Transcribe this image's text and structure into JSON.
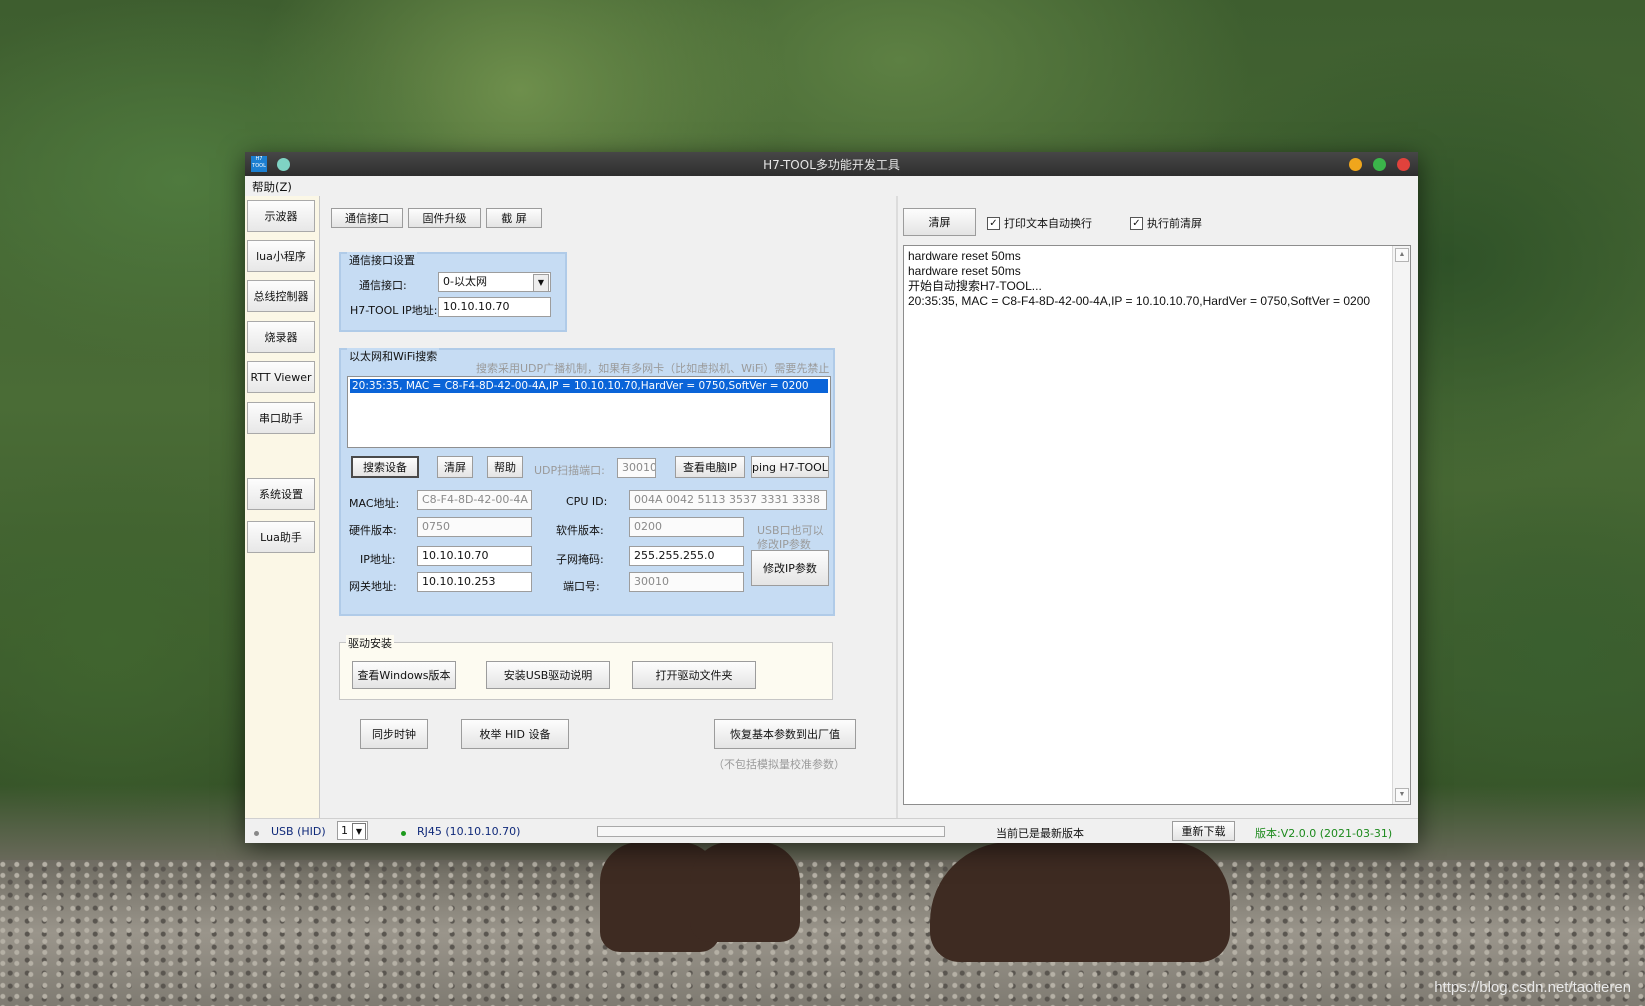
{
  "window": {
    "title": "H7-TOOL多功能开发工具",
    "logo_text": "H7 TOOL"
  },
  "menubar": {
    "help": "帮助(Z)"
  },
  "sidebar": {
    "items": [
      "示波器",
      "lua小程序",
      "总线控制器",
      "烧录器",
      "RTT Viewer",
      "串口助手",
      "系统设置",
      "Lua助手"
    ]
  },
  "tabs": [
    "通信接口",
    "固件升级",
    "截 屏"
  ],
  "comm_settings": {
    "title": "通信接口设置",
    "interface_label": "通信接口:",
    "interface_value": "0-以太网",
    "ip_label": "H7-TOOL IP地址:",
    "ip_value": "10.10.10.70"
  },
  "search": {
    "title": "以太网和WiFi搜索",
    "hint": "搜索采用UDP广播机制，如果有多网卡（比如虚拟机、WiFi）需要先禁止",
    "results": [
      "20:35:35, MAC = C8-F4-8D-42-00-4A,IP = 10.10.10.70,HardVer = 0750,SoftVer = 0200"
    ],
    "search_btn": "搜索设备",
    "clear_btn": "清屏",
    "help_btn": "帮助",
    "udp_port_label": "UDP扫描端口:",
    "udp_port_value": "30010",
    "view_pc_ip_btn": "查看电脑IP",
    "ping_btn": "ping H7-TOOL",
    "mac_label": "MAC地址:",
    "mac_value": "C8-F4-8D-42-00-4A",
    "cpu_label": "CPU ID:",
    "cpu_value": "004A 0042 5113 3537 3331 3338",
    "hw_label": "硬件版本:",
    "hw_value": "0750",
    "sw_label": "软件版本:",
    "sw_value": "0200",
    "usb_note_1": "USB口也可以",
    "usb_note_2": "修改IP参数",
    "ip_label": "IP地址:",
    "ip_value": "10.10.10.70",
    "mask_label": "子网掩码:",
    "mask_value": "255.255.255.0",
    "modify_btn": "修改IP参数",
    "gw_label": "网关地址:",
    "gw_value": "10.10.10.253",
    "port_label": "端口号:",
    "port_value": "30010"
  },
  "driver": {
    "title": "驱动安装",
    "btn1": "查看Windows版本",
    "btn2": "安装USB驱动说明",
    "btn3": "打开驱动文件夹"
  },
  "bottom": {
    "sync_btn": "同步时钟",
    "hid_btn": "枚举 HID 设备",
    "restore_btn": "恢复基本参数到出厂值",
    "restore_note": "（不包括模拟量校准参数）"
  },
  "log": {
    "clear_btn": "清屏",
    "wrap_label": "打印文本自动换行",
    "clear_before_label": "执行前清屏",
    "lines": [
      "hardware reset 50ms",
      "hardware reset 50ms",
      "开始自动搜索H7-TOOL...",
      "20:35:35, MAC = C8-F4-8D-42-00-4A,IP = 10.10.10.70,HardVer = 0750,SoftVer = 0200"
    ]
  },
  "status": {
    "usb": "USB (HID)",
    "channel": "1",
    "rj45": "RJ45 (10.10.10.70)",
    "latest": "当前已是最新版本",
    "redownload_btn": "重新下载",
    "version": "版本:V2.0.0 (2021-03-31)"
  },
  "watermark": "https://blog.csdn.net/taotieren",
  "colors": {
    "accent": "#0a64d8",
    "version_green": "#1d8a1d",
    "status_navy": "#102a7a",
    "sidebar_bg": "#fbf7e6",
    "group_blue": "#c6dcf3",
    "driver_bg": "#fdfbf1"
  }
}
